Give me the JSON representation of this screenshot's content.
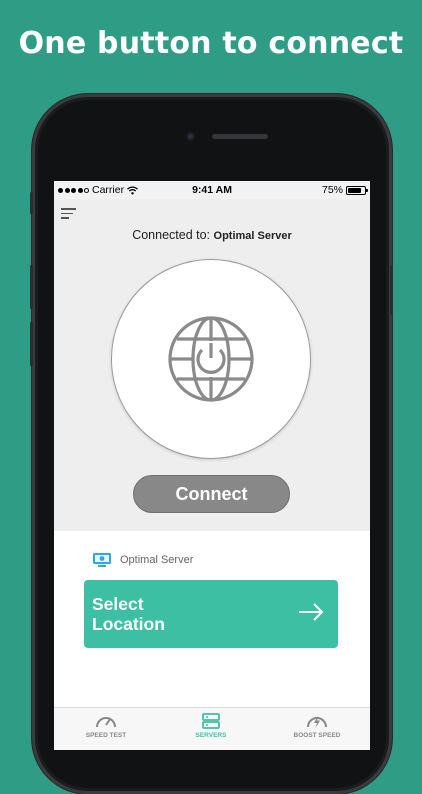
{
  "headline": "One button to connect",
  "status_bar": {
    "carrier": "Carrier",
    "time": "9:41 AM",
    "battery": "75%"
  },
  "main": {
    "connected_prefix": "Connected to:",
    "connected_server": "Optimal Server",
    "connect_label": "Connect"
  },
  "server": {
    "name": "Optimal Server",
    "select_label": "Select\nLocation"
  },
  "tabs": [
    {
      "label": "SPEED TEST",
      "icon": "speedometer-icon",
      "active": false
    },
    {
      "label": "SERVERS",
      "icon": "server-icon",
      "active": true
    },
    {
      "label": "BOOST SPEED",
      "icon": "boost-icon",
      "active": false
    }
  ],
  "colors": {
    "background": "#2f9d86",
    "accent": "#3dbfa3",
    "connect_button": "#888888"
  }
}
